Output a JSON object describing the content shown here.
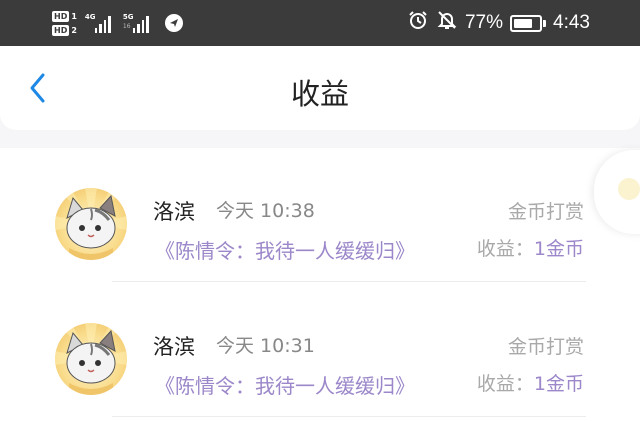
{
  "status_bar": {
    "hd1": "HD",
    "hd1_num": "1",
    "hd2": "HD",
    "hd2_num": "2",
    "net1": "4G",
    "net2": "5G",
    "net2_sub": "16",
    "battery_percent": "77%",
    "battery_level": 0.77,
    "time": "4:43",
    "icons": [
      "alarm-icon",
      "mute-icon",
      "battery-icon"
    ]
  },
  "header": {
    "title": "收益",
    "back_icon": "chevron-left-icon",
    "accent": "#1e88e5"
  },
  "records": [
    {
      "name": "洛滨",
      "time": "今天 10:38",
      "book": "《陈情令：我待一人缓缓归》",
      "type": "金币打赏",
      "income_label": "收益：",
      "income_amount": "1金币"
    },
    {
      "name": "洛滨",
      "time": "今天 10:31",
      "book": "《陈情令：我待一人缓缓归》",
      "type": "金币打赏",
      "income_label": "收益：",
      "income_amount": "1金币"
    }
  ],
  "colors": {
    "link_purple": "#9b87c9",
    "muted_gray": "#a9a9a9",
    "status_bar_bg": "#3b3b3b"
  }
}
